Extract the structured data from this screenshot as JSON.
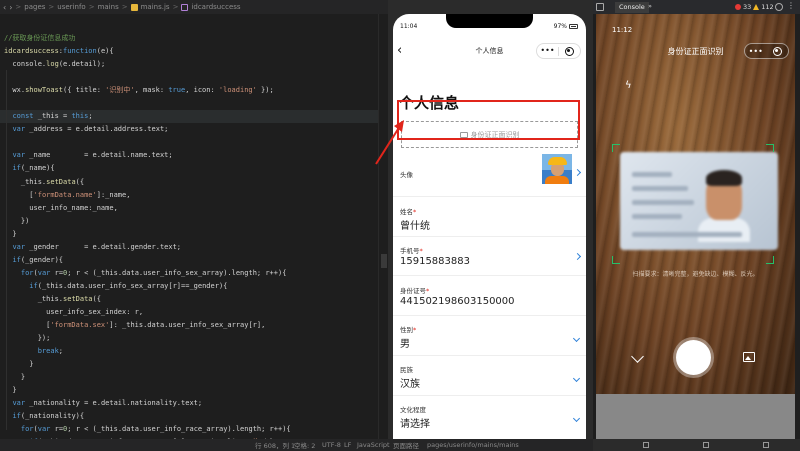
{
  "editor": {
    "breadcrumb": {
      "back": "‹",
      "forward": "›",
      "p1": "pages",
      "p2": "userinfo",
      "p3": "mains",
      "file": "mains.js",
      "symbol": "idcardsuccess",
      "sep": ">"
    },
    "lines": [
      [
        {
          "t": "//获取身份证信息成功",
          "c": "c-com"
        }
      ],
      [
        {
          "t": "idcardsuccess",
          "c": "c-fn"
        },
        {
          "t": ":",
          "c": ""
        },
        {
          "t": "function",
          "c": "c-kw"
        },
        {
          "t": "(e){",
          "c": ""
        }
      ],
      [
        {
          "t": "  console.",
          "c": ""
        },
        {
          "t": "log",
          "c": "c-fn"
        },
        {
          "t": "(e.detail);",
          "c": ""
        }
      ],
      [],
      [
        {
          "t": "  wx.",
          "c": ""
        },
        {
          "t": "showToast",
          "c": "c-fn"
        },
        {
          "t": "({ title: ",
          "c": ""
        },
        {
          "t": "'识别中'",
          "c": "c-str"
        },
        {
          "t": ", mask: ",
          "c": ""
        },
        {
          "t": "true",
          "c": "c-kw"
        },
        {
          "t": ", icon: ",
          "c": ""
        },
        {
          "t": "'loading'",
          "c": "c-str"
        },
        {
          "t": " });",
          "c": ""
        }
      ],
      [],
      [
        {
          "t": "  ",
          "c": ""
        },
        {
          "t": "const",
          "c": "c-kw"
        },
        {
          "t": " _this = ",
          "c": ""
        },
        {
          "t": "this",
          "c": "c-kw"
        },
        {
          "t": ";",
          "c": ""
        }
      ],
      [
        {
          "t": "  ",
          "c": ""
        },
        {
          "t": "var",
          "c": "c-kw"
        },
        {
          "t": " _address = e.detail.address.text;",
          "c": ""
        }
      ],
      [],
      [
        {
          "t": "  ",
          "c": ""
        },
        {
          "t": "var",
          "c": "c-kw"
        },
        {
          "t": " _name        = e.detail.name.text;",
          "c": ""
        }
      ],
      [
        {
          "t": "  ",
          "c": ""
        },
        {
          "t": "if",
          "c": "c-kw"
        },
        {
          "t": "(_name){",
          "c": ""
        }
      ],
      [
        {
          "t": "    _this.",
          "c": ""
        },
        {
          "t": "setData",
          "c": "c-fn"
        },
        {
          "t": "({",
          "c": ""
        }
      ],
      [
        {
          "t": "      [",
          "c": ""
        },
        {
          "t": "'formData.name'",
          "c": "c-str"
        },
        {
          "t": "]:_name,",
          "c": ""
        }
      ],
      [
        {
          "t": "      user_info_name:_name,",
          "c": ""
        }
      ],
      [
        {
          "t": "    })",
          "c": ""
        }
      ],
      [
        {
          "t": "  }",
          "c": ""
        }
      ],
      [
        {
          "t": "  ",
          "c": ""
        },
        {
          "t": "var",
          "c": "c-kw"
        },
        {
          "t": " _gender      = e.detail.gender.text;",
          "c": ""
        }
      ],
      [
        {
          "t": "  ",
          "c": ""
        },
        {
          "t": "if",
          "c": "c-kw"
        },
        {
          "t": "(_gender){",
          "c": ""
        }
      ],
      [
        {
          "t": "    ",
          "c": ""
        },
        {
          "t": "for",
          "c": "c-kw"
        },
        {
          "t": "(",
          "c": ""
        },
        {
          "t": "var",
          "c": "c-kw"
        },
        {
          "t": " r=",
          "c": ""
        },
        {
          "t": "0",
          "c": "c-num"
        },
        {
          "t": "; r < (_this.data.user_info_sex_array).length; r++){",
          "c": ""
        }
      ],
      [
        {
          "t": "      ",
          "c": ""
        },
        {
          "t": "if",
          "c": "c-kw"
        },
        {
          "t": "(_this.data.user_info_sex_array[r]==_gender){",
          "c": ""
        }
      ],
      [
        {
          "t": "        _this.",
          "c": ""
        },
        {
          "t": "setData",
          "c": "c-fn"
        },
        {
          "t": "({",
          "c": ""
        }
      ],
      [
        {
          "t": "          user_info_sex_index: r,",
          "c": ""
        }
      ],
      [
        {
          "t": "          [",
          "c": ""
        },
        {
          "t": "'formData.sex'",
          "c": "c-str"
        },
        {
          "t": "]: _this.data.user_info_sex_array[r],",
          "c": ""
        }
      ],
      [
        {
          "t": "        });",
          "c": ""
        }
      ],
      [
        {
          "t": "        ",
          "c": ""
        },
        {
          "t": "break",
          "c": "c-kw"
        },
        {
          "t": ";",
          "c": ""
        }
      ],
      [
        {
          "t": "      }",
          "c": ""
        }
      ],
      [
        {
          "t": "    }",
          "c": ""
        }
      ],
      [
        {
          "t": "  }",
          "c": ""
        }
      ],
      [
        {
          "t": "  ",
          "c": ""
        },
        {
          "t": "var",
          "c": "c-kw"
        },
        {
          "t": " _nationality = e.detail.nationality.text;",
          "c": ""
        }
      ],
      [
        {
          "t": "  ",
          "c": ""
        },
        {
          "t": "if",
          "c": "c-kw"
        },
        {
          "t": "(_nationality){",
          "c": ""
        }
      ],
      [
        {
          "t": "    ",
          "c": ""
        },
        {
          "t": "for",
          "c": "c-kw"
        },
        {
          "t": "(",
          "c": ""
        },
        {
          "t": "var",
          "c": "c-kw"
        },
        {
          "t": " r=",
          "c": ""
        },
        {
          "t": "0",
          "c": "c-num"
        },
        {
          "t": "; r < (_this.data.user_info_race_array).length; r++){",
          "c": ""
        }
      ],
      [
        {
          "t": "      ",
          "c": ""
        },
        {
          "t": "if",
          "c": "c-kw"
        },
        {
          "t": "( this.data.user info race array[r]== nationality+",
          "c": ""
        },
        {
          "t": "\"族\"",
          "c": "c-str"
        },
        {
          "t": "){",
          "c": ""
        }
      ]
    ],
    "current_line_index": 6
  },
  "status": {
    "position": "行 608，列 1",
    "spaces": "空格: 2",
    "encoding": "UTF-8",
    "eol": "LF",
    "language": "JavaScript",
    "page_path_label": "页面路径",
    "page_path": "pages/userinfo/mains/mains"
  },
  "phone": {
    "time": "11:04",
    "battery": "97%",
    "nav_title": "个人信息",
    "capsule_more": "•••",
    "back": "‹",
    "heading": "个人信息",
    "id_button_label": "身份证正面识别",
    "fields": [
      {
        "key": "avatar",
        "label": "头像",
        "required": false,
        "value": ""
      },
      {
        "key": "name",
        "label": "姓名",
        "required": true,
        "value": "曾什统"
      },
      {
        "key": "phone",
        "label": "手机号",
        "required": true,
        "value": "15915883883"
      },
      {
        "key": "idno",
        "label": "身份证号",
        "required": true,
        "value": "441502198603150000"
      },
      {
        "key": "gender",
        "label": "性别",
        "required": true,
        "value": "男"
      },
      {
        "key": "ethnic",
        "label": "民族",
        "required": false,
        "value": "汉族"
      },
      {
        "key": "education",
        "label": "文化程度",
        "required": false,
        "value": "请选择"
      }
    ],
    "required_mark": "*"
  },
  "devtools": {
    "tab": "Console",
    "more": "»",
    "errors": "33",
    "warnings": "112"
  },
  "camera": {
    "time": "11:12",
    "title": "身份证正面识别",
    "hint": "扫描要求：清晰完整，避免缺边、模糊、反光。",
    "flash_icon": "ϟ",
    "capsule_more": "•••"
  },
  "colors": {
    "highlight": "#e1251b",
    "scan_corner": "#25c06a",
    "accent_chevron": "#2f82d9"
  }
}
